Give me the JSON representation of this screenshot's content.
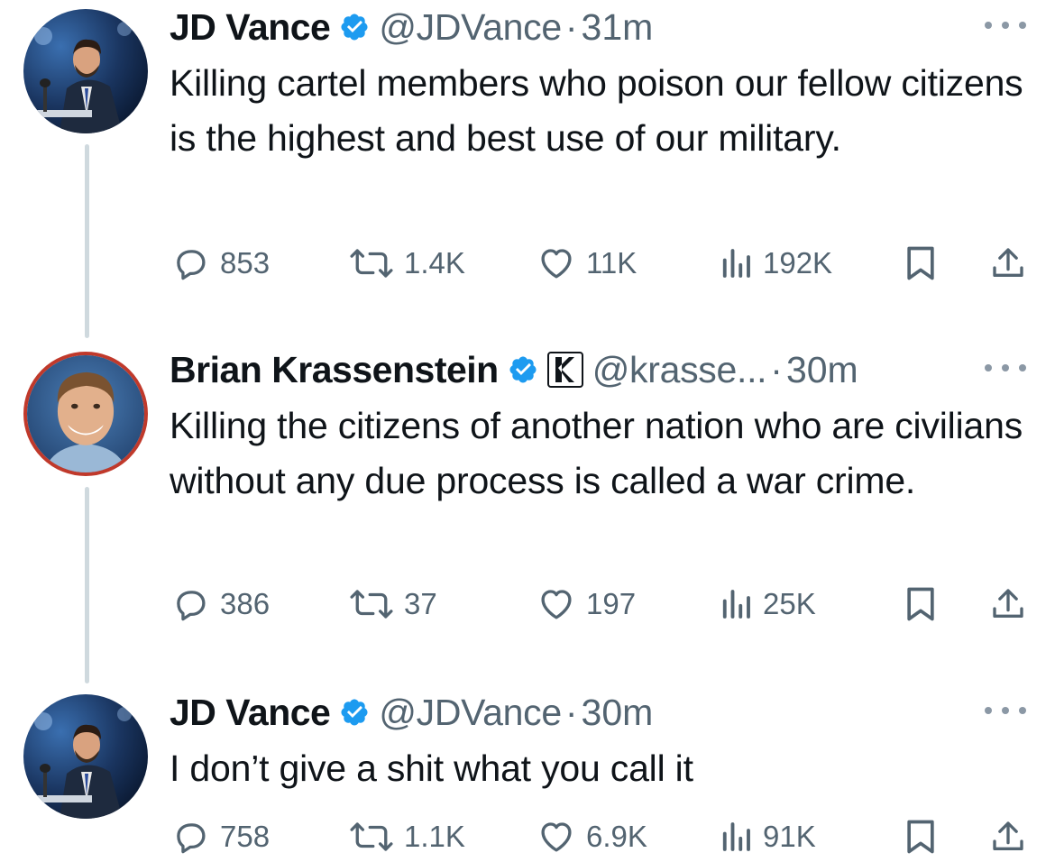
{
  "tweets": [
    {
      "name": "JD Vance",
      "handle": "@JDVance",
      "separator": "·",
      "time": "31m",
      "text": "Killing cartel members who poison our fellow citizens is the highest and best use of our military.",
      "replies": "853",
      "reposts": "1.4K",
      "likes": "11K",
      "views": "192K",
      "verified_icon": "verified-badge-icon",
      "avatar": "jd-vance-avatar"
    },
    {
      "name": "Brian Krassenstein",
      "handle": "@krasse...",
      "separator": "·",
      "time": "30m",
      "text": "Killing the citizens of another nation who are civilians without any due process is called a war crime.",
      "replies": "386",
      "reposts": "37",
      "likes": "197",
      "views": "25K",
      "verified_icon": "verified-badge-icon",
      "affiliate_icon": "k-affiliate-badge-icon",
      "avatar": "brian-krassenstein-avatar"
    },
    {
      "name": "JD Vance",
      "handle": "@JDVance",
      "separator": "·",
      "time": "30m",
      "text": "I don’t give a shit what you call it",
      "replies": "758",
      "reposts": "1.1K",
      "likes": "6.9K",
      "views": "91K",
      "verified_icon": "verified-badge-icon",
      "avatar": "jd-vance-avatar"
    }
  ],
  "colors": {
    "text": "#0f1419",
    "secondary": "#536471",
    "verified": "#1d9bf0",
    "thread_line": "#cfd9de",
    "avatar_ring": "#c0392b"
  }
}
